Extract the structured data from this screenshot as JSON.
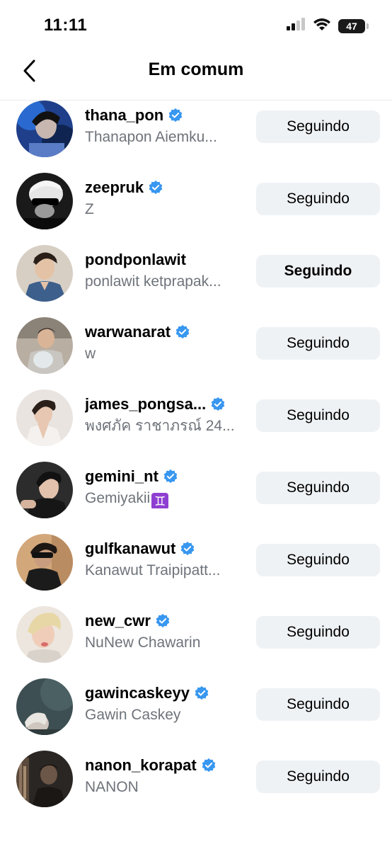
{
  "status_bar": {
    "time": "11:11",
    "battery": "47"
  },
  "nav": {
    "title": "Em comum"
  },
  "users": [
    {
      "username": "thana_pon",
      "name": "Thanapon  Aiemku...",
      "verified": true,
      "button": "Seguindo"
    },
    {
      "username": "zeepruk",
      "name": "Z",
      "verified": true,
      "button": "Seguindo"
    },
    {
      "username": "pondponlawit",
      "name": "ponlawit ketprapak...",
      "verified": false,
      "button": "Seguindo"
    },
    {
      "username": "warwanarat",
      "name": "w",
      "verified": true,
      "button": "Seguindo"
    },
    {
      "username": "james_pongsa...",
      "name": "พงศภัค ราชาภรณ์ 24...",
      "verified": true,
      "button": "Seguindo"
    },
    {
      "username": "gemini_nt",
      "name": "Gemiyakii",
      "verified": true,
      "button": "Seguindo"
    },
    {
      "username": "gulfkanawut",
      "name": "Kanawut Traipipatt...",
      "verified": true,
      "button": "Seguindo"
    },
    {
      "username": "new_cwr",
      "name": "NuNew Chawarin",
      "verified": true,
      "button": "Seguindo"
    },
    {
      "username": "gawincaskeyy",
      "name": "Gawin Caskey",
      "verified": true,
      "button": "Seguindo"
    },
    {
      "username": "nanon_korapat",
      "name": "NANON",
      "verified": true,
      "button": "Seguindo"
    }
  ],
  "colors": {
    "verified": "#3897f0",
    "button_bg": "#eff2f5",
    "secondary_text": "#6e737a"
  },
  "icons": {
    "back": "chevron-left-icon",
    "verified": "verified-badge-icon",
    "gemini": "gemini-zodiac-icon"
  }
}
